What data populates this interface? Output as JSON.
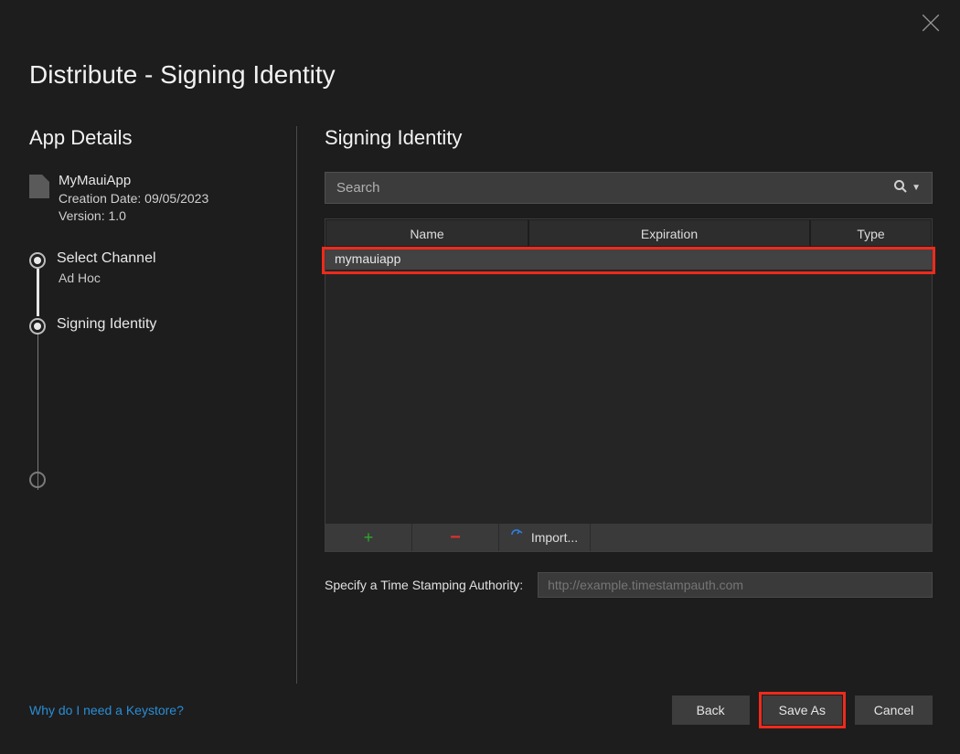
{
  "window_title": "Distribute - Signing Identity",
  "sidebar": {
    "title": "App Details",
    "app": {
      "name": "MyMauiApp",
      "creation_line": "Creation Date: 09/05/2023",
      "version_line": "Version: 1.0"
    },
    "steps": {
      "select_channel": {
        "label": "Select Channel",
        "sub": "Ad Hoc"
      },
      "signing_identity": {
        "label": "Signing Identity"
      }
    }
  },
  "main": {
    "title": "Signing Identity",
    "search_placeholder": "Search",
    "columns": {
      "name": "Name",
      "expiration": "Expiration",
      "type": "Type"
    },
    "rows": [
      {
        "name": "mymauiapp",
        "expiration": "",
        "type": ""
      }
    ],
    "toolbar": {
      "import_label": "Import..."
    },
    "tsa_label": "Specify a Time Stamping Authority:",
    "tsa_placeholder": "http://example.timestampauth.com"
  },
  "footer": {
    "help_link": "Why do I need a Keystore?",
    "back": "Back",
    "save_as": "Save As",
    "cancel": "Cancel"
  }
}
